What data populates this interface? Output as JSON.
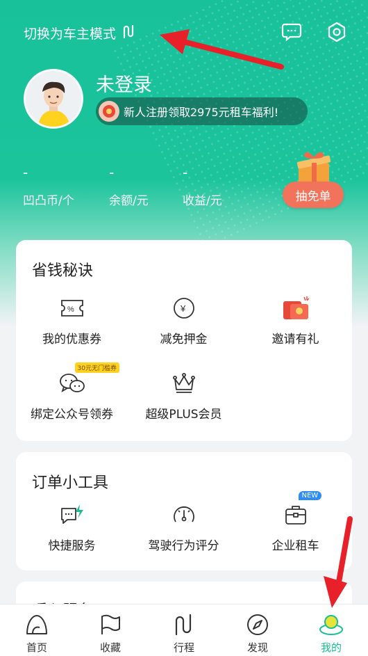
{
  "header": {
    "switch_mode_label": "切换为车主模式"
  },
  "profile": {
    "login_status": "未登录",
    "promo_text": "新人注册领取2975元租车福利!"
  },
  "stats": [
    {
      "value": "-",
      "label": "凹凸币/个"
    },
    {
      "value": "-",
      "label": "余额/元"
    },
    {
      "value": "-",
      "label": "收益/元"
    }
  ],
  "lottery": {
    "label": "抽免单"
  },
  "savings": {
    "title": "省钱秘诀",
    "items": [
      {
        "label": "我的优惠券",
        "icon": "coupon-icon"
      },
      {
        "label": "减免押金",
        "icon": "yen-coin-icon"
      },
      {
        "label": "邀请有礼",
        "icon": "red-envelope-icon"
      },
      {
        "label": "绑定公众号领券",
        "icon": "wechat-icon",
        "tag": "30元无门槛券"
      },
      {
        "label": "超级PLUS会员",
        "icon": "crown-icon"
      }
    ]
  },
  "tools": {
    "title": "订单小工具",
    "items": [
      {
        "label": "快捷服务",
        "icon": "quick-service-icon"
      },
      {
        "label": "驾驶行为评分",
        "icon": "speedometer-icon"
      },
      {
        "label": "企业租车",
        "icon": "briefcase-icon",
        "tag": "NEW"
      }
    ]
  },
  "partial_card": {
    "title": "暖心服务"
  },
  "tabbar": [
    {
      "label": "首页",
      "icon": "home-icon"
    },
    {
      "label": "收藏",
      "icon": "flag-icon"
    },
    {
      "label": "行程",
      "icon": "route-icon"
    },
    {
      "label": "发现",
      "icon": "compass-icon"
    },
    {
      "label": "我的",
      "icon": "profile-icon",
      "active": true
    }
  ],
  "colors": {
    "brand_green": "#19be92",
    "draw_button": "#f2735c",
    "annotation_red": "#e8202a"
  }
}
